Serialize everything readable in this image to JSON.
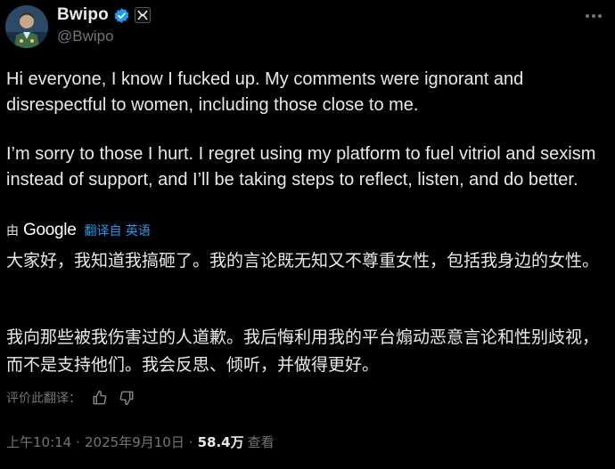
{
  "author": {
    "display_name": "Bwipo",
    "handle": "@Bwipo",
    "verified_icon": "verified-badge-icon",
    "affiliation_icon": "team-affiliation-icon"
  },
  "post": {
    "en_paragraph_1": "Hi everyone, I know I fucked up. My comments were ignorant and disrespectful to women, including those close to me.",
    "en_paragraph_2": "I’m sorry to those I hurt. I regret using my platform to fuel vitriol and sexism instead of support, and I’ll be taking steps to reflect, listen, and do better.",
    "translation": {
      "by_label": "由",
      "provider": "Google",
      "link_label": "翻译自 英语"
    },
    "zh_paragraph_1": "大家好，我知道我搞砸了。我的言论既无知又不尊重女性，包括我身边的女性。",
    "zh_paragraph_2": "我向那些被我伤害过的人道歉。我后悔利用我的平台煽动恶意言论和性别歧视，而不是支持他们。我会反思、倾听，并做得更好。"
  },
  "rate_translation": {
    "label": "评价此翻译：",
    "thumbs_up_icon": "thumbs-up-icon",
    "thumbs_down_icon": "thumbs-down-icon"
  },
  "meta": {
    "time": "上午10:14",
    "separator": "·",
    "date": "2025年9月10日",
    "views_count": "58.4万",
    "views_label": "查看"
  },
  "colors": {
    "background": "#000000",
    "text": "#e7e9ea",
    "muted": "#71767b",
    "link": "#1d9bf0",
    "verified": "#1d9bf0"
  }
}
